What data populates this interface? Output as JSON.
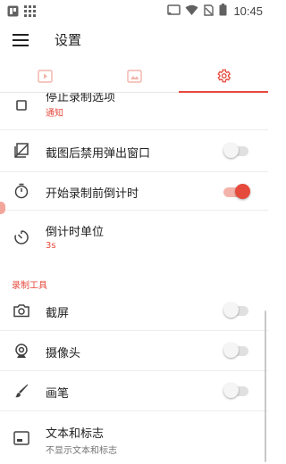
{
  "status_bar": {
    "time": "10:45"
  },
  "app_bar": {
    "title": "设置"
  },
  "tabs": [
    {
      "icon": "video-icon",
      "active": false
    },
    {
      "icon": "image-icon",
      "active": false
    },
    {
      "icon": "gear-icon",
      "active": true
    }
  ],
  "settings": {
    "stop_record_option": {
      "title": "停止录制选项",
      "subtitle": "通知"
    },
    "disable_popup": {
      "title": "截图后禁用弹出窗口",
      "enabled": false
    },
    "countdown": {
      "title": "开始录制前倒计时",
      "enabled": true
    },
    "countdown_unit": {
      "title": "倒计时单位",
      "value": "3s"
    }
  },
  "tools_section": {
    "header": "录制工具",
    "items": [
      {
        "title": "截屏",
        "icon": "camera-icon",
        "enabled": false
      },
      {
        "title": "摄像头",
        "icon": "webcam-icon",
        "enabled": false
      },
      {
        "title": "画笔",
        "icon": "brush-icon",
        "enabled": false
      }
    ],
    "text_logo": {
      "title": "文本和标志",
      "subtitle": "不显示文本和标志"
    }
  },
  "colors": {
    "accent": "#e64a3c",
    "text_primary": "#212121",
    "text_secondary": "#757575",
    "divider": "#ececec"
  }
}
